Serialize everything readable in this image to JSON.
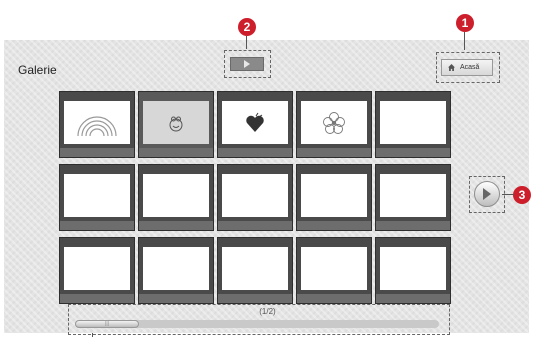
{
  "header": {
    "title": "Galerie"
  },
  "home_button": {
    "label": "Acasă",
    "icon": "home-icon"
  },
  "play_button": {
    "icon": "play-icon"
  },
  "callouts": [
    "1",
    "2",
    "3"
  ],
  "gallery": {
    "items": [
      {
        "icon": "rainbow-icon",
        "selected": false
      },
      {
        "icon": "bug-icon",
        "selected": true
      },
      {
        "icon": "heart-icon",
        "selected": false
      },
      {
        "icon": "flower-icon",
        "selected": false
      },
      {
        "icon": "",
        "selected": false
      },
      {
        "icon": "",
        "selected": false
      },
      {
        "icon": "",
        "selected": false
      },
      {
        "icon": "",
        "selected": false
      },
      {
        "icon": "",
        "selected": false
      },
      {
        "icon": "",
        "selected": false
      },
      {
        "icon": "",
        "selected": false
      },
      {
        "icon": "",
        "selected": false
      },
      {
        "icon": "",
        "selected": false
      },
      {
        "icon": "",
        "selected": false
      },
      {
        "icon": "",
        "selected": false
      }
    ]
  },
  "pagination": {
    "label": "(1/2)"
  },
  "colors": {
    "callout": "#cc1f2b",
    "card": "#4a4a4a",
    "background": "#e4e4e4"
  }
}
